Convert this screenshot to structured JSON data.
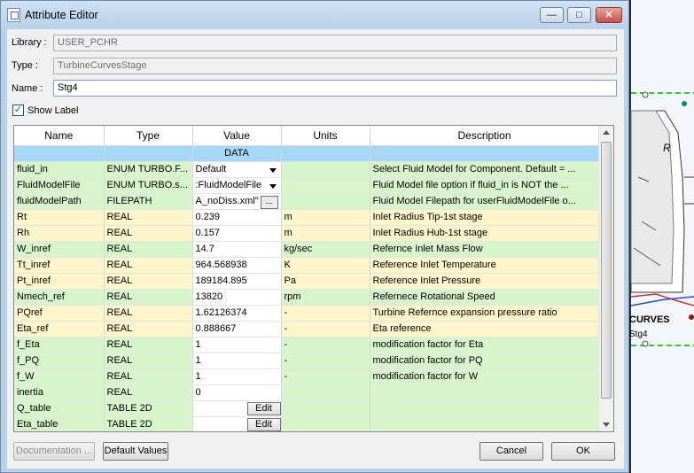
{
  "window": {
    "title": "Attribute Editor",
    "minimize": "—",
    "maximize": "□",
    "close": "✕"
  },
  "form": {
    "library_label": "Library :",
    "library_value": "USER_PCHR",
    "type_label": "Type :",
    "type_value": "TurbineCurvesStage",
    "name_label": "Name :",
    "name_value": "Stg4",
    "show_label": "Show Label",
    "show_label_checked": true
  },
  "table": {
    "columns": [
      "Name",
      "Type",
      "Value",
      "Units",
      "Description"
    ],
    "section": "DATA",
    "rows": [
      {
        "name": "fluid_in",
        "type": "ENUM TURBO.F...",
        "value": "Default",
        "units": "",
        "desc": "Select Fluid Model for Component. Default = ...",
        "color": "g",
        "widget": "select"
      },
      {
        "name": "FluidModelFile",
        "type": "ENUM TURBO.s...",
        "value": ":FluidModelFile",
        "units": "",
        "desc": "Fluid Model file option if fluid_in is NOT the ...",
        "color": "g",
        "widget": "select"
      },
      {
        "name": "fluidModelPath",
        "type": "FILEPATH",
        "value": "A_noDiss.xml\"",
        "units": "",
        "desc": "Fluid Model Filepath for userFluidModelFile o...",
        "color": "g",
        "widget": "file"
      },
      {
        "name": "Rt",
        "type": "REAL",
        "value": "0.239",
        "units": "m",
        "desc": "Inlet Radius Tip-1st stage",
        "color": "y"
      },
      {
        "name": "Rh",
        "type": "REAL",
        "value": "0.157",
        "units": "m",
        "desc": "Inlet Radius Hub-1st stage",
        "color": "y"
      },
      {
        "name": "W_inref",
        "type": "REAL",
        "value": "14.7",
        "units": "kg/sec",
        "desc": "Refernce Inlet Mass Flow",
        "color": "g"
      },
      {
        "name": "Tt_inref",
        "type": "REAL",
        "value": "964.568938",
        "units": "K",
        "desc": "Reference Inlet Temperature",
        "color": "y"
      },
      {
        "name": "Pt_inref",
        "type": "REAL",
        "value": "189184.895",
        "units": "Pa",
        "desc": "Reference Inlet Pressure",
        "color": "y"
      },
      {
        "name": "Nmech_ref",
        "type": "REAL",
        "value": "13820",
        "units": "rpm",
        "desc": "Refernece Rotational Speed",
        "color": "g"
      },
      {
        "name": "PQref",
        "type": "REAL",
        "value": "1.62126374",
        "units": "-",
        "desc": "Turbine Refernce expansion pressure ratio",
        "color": "y"
      },
      {
        "name": "Eta_ref",
        "type": "REAL",
        "value": "0.888667",
        "units": "-",
        "desc": "Eta reference",
        "color": "y"
      },
      {
        "name": "f_Eta",
        "type": "REAL",
        "value": "1",
        "units": "-",
        "desc": "modification factor for Eta",
        "color": "g"
      },
      {
        "name": "f_PQ",
        "type": "REAL",
        "value": "1",
        "units": "-",
        "desc": "modification factor for PQ",
        "color": "g"
      },
      {
        "name": "f_W",
        "type": "REAL",
        "value": "1",
        "units": "-",
        "desc": "modification factor for W",
        "color": "g"
      },
      {
        "name": "inertia",
        "type": "REAL",
        "value": "0",
        "units": "",
        "desc": "",
        "color": "g"
      },
      {
        "name": "Q_table",
        "type": "TABLE 2D",
        "value": "Edit",
        "units": "",
        "desc": "",
        "color": "g",
        "widget": "button"
      },
      {
        "name": "Eta_table",
        "type": "TABLE 2D",
        "value": "Edit",
        "units": "",
        "desc": "",
        "color": "g",
        "widget": "button"
      }
    ]
  },
  "buttons": {
    "documentation": "Documentation ...",
    "default_values": "Default Values",
    "cancel": "Cancel",
    "ok": "OK"
  },
  "background": {
    "shape_label": "R",
    "curves_label": "CURVES",
    "stage_label": "Stg4"
  }
}
